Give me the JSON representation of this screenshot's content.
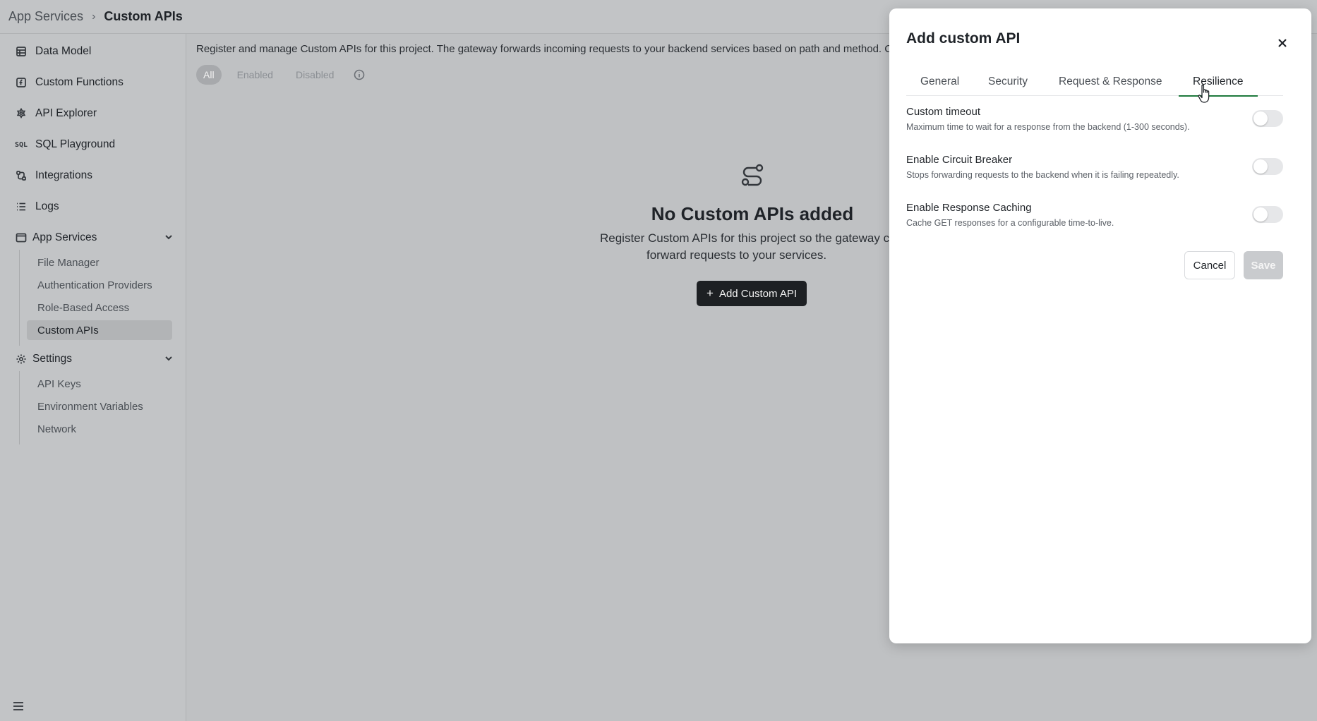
{
  "breadcrumb": {
    "root": "App Services",
    "separator": "›",
    "current": "Custom APIs"
  },
  "sidebar": {
    "items": [
      {
        "label": "Data Model",
        "icon": "table-icon"
      },
      {
        "label": "Custom Functions",
        "icon": "function-icon"
      },
      {
        "label": "API Explorer",
        "icon": "api-explorer-icon"
      },
      {
        "label": "SQL Playground",
        "icon": "sql-icon",
        "icon_text": "SQL"
      },
      {
        "label": "Integrations",
        "icon": "integrations-icon"
      },
      {
        "label": "Logs",
        "icon": "list-icon"
      }
    ],
    "app_services": {
      "label": "App Services",
      "items": [
        "File Manager",
        "Authentication Providers",
        "Role-Based Access",
        "Custom APIs"
      ],
      "active": "Custom APIs"
    },
    "settings": {
      "label": "Settings",
      "items": [
        "API Keys",
        "Environment Variables",
        "Network"
      ]
    }
  },
  "main": {
    "description": "Register and manage Custom APIs for this project. The gateway forwards incoming requests to your backend services based on path and method. C",
    "filters": [
      "All",
      "Enabled",
      "Disabled"
    ],
    "active_filter": "All",
    "empty_state": {
      "title": "No Custom APIs added",
      "text_line1": "Register Custom APIs for this project so the gateway c",
      "text_line2": "forward requests to your services.",
      "button": "Add Custom API",
      "button_icon": "+"
    }
  },
  "modal": {
    "title": "Add custom API",
    "tabs": [
      "General",
      "Security",
      "Request & Response",
      "Resilience"
    ],
    "active_tab": "Resilience",
    "settings": [
      {
        "title": "Custom timeout",
        "description": "Maximum time to wait for a response from the backend (1-300 seconds).",
        "enabled": false
      },
      {
        "title": "Enable Circuit Breaker",
        "description": "Stops forwarding requests to the backend when it is failing repeatedly.",
        "enabled": false
      },
      {
        "title": "Enable Response Caching",
        "description": "Cache GET responses for a configurable time-to-live.",
        "enabled": false
      }
    ],
    "cancel_label": "Cancel",
    "save_label": "Save"
  },
  "colors": {
    "accent_tab": "#1f7a3d",
    "primary_button": "#1d2023",
    "overlay": "#bfc1c3"
  }
}
